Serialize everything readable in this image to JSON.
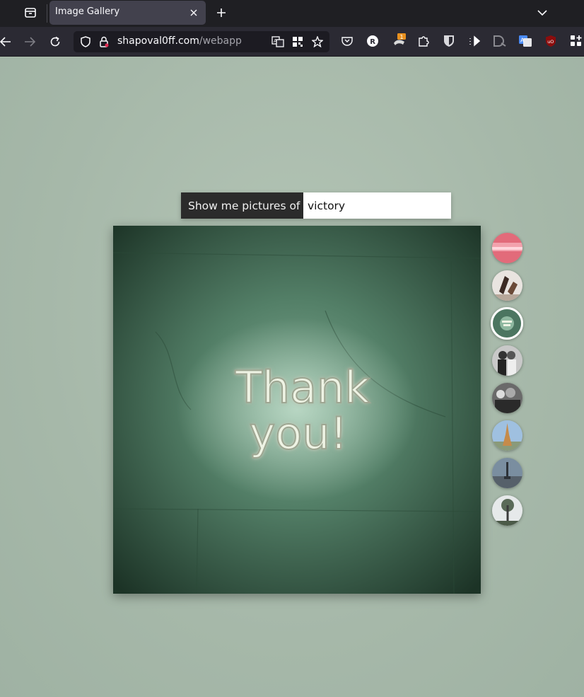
{
  "browser": {
    "tab": {
      "title": "Image Gallery"
    },
    "url": {
      "host": "shapoval0ff.com",
      "path": "/webapp"
    },
    "extension_badge": "1"
  },
  "gallery": {
    "search_label": "Show me pictures of",
    "search_value": "victory",
    "main_image": {
      "text_line1": "Thank",
      "text_line2": "you!"
    },
    "thumbnails": [
      {
        "name": "pink-abstract",
        "active": false
      },
      {
        "name": "chess-pieces",
        "active": false
      },
      {
        "name": "thank-you-neon",
        "active": true
      },
      {
        "name": "bw-couple",
        "active": false
      },
      {
        "name": "bw-crowd",
        "active": false
      },
      {
        "name": "eiffel-tower",
        "active": false
      },
      {
        "name": "city-monument",
        "active": false
      },
      {
        "name": "tree-tower",
        "active": false
      }
    ]
  }
}
